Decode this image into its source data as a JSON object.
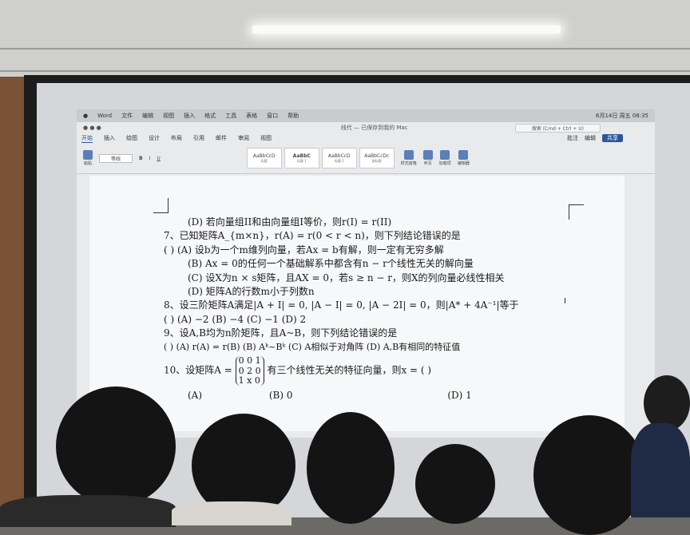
{
  "menubar": {
    "items": [
      "Word",
      "文件",
      "编辑",
      "视图",
      "插入",
      "格式",
      "工具",
      "表格",
      "窗口",
      "帮助"
    ],
    "clock": "6月14日 周五 08:35"
  },
  "titlebar": {
    "doc_title": "线代 — 已保存到我的 Mac",
    "search_placeholder": "搜索 (Cmd + Ctrl + U)"
  },
  "tabs": [
    "开始",
    "插入",
    "绘图",
    "设计",
    "布局",
    "引用",
    "邮件",
    "审阅",
    "视图"
  ],
  "tab_right": {
    "comments": "批注",
    "editing": "编辑",
    "share": "共享"
  },
  "ribbon": {
    "paste": "粘贴",
    "font": "等线",
    "styles": [
      {
        "sample": "AaBbCcD",
        "label": "标题"
      },
      {
        "sample": "AaBbC",
        "label": "标题 1"
      },
      {
        "sample": "AaBbCcD",
        "label": "标题 2"
      },
      {
        "sample": "AaBbCcDc",
        "label": "副标题"
      }
    ],
    "buttons": [
      "样式窗格",
      "听写",
      "加载项",
      "编辑器"
    ]
  },
  "document": {
    "lines": [
      "(D)  若向量组II和由向量组I等价，则r(I) = r(II)",
      "7、已知矩阵A_{m×n}，r(A) = r(0 < r < n)，则下列结论错误的是",
      "(    )     (A)  设b为一个m维列向量，若Ax = b有解，则一定有无穷多解",
      "(B)  Ax = 0的任何一个基础解系中都含有n − r个线性无关的解向量",
      "(C)  设X为n × s矩阵，且AX = 0，若s ≥ n − r，则X的列向量必线性相关",
      "(D)  矩阵A的行数m小于列数n",
      "8、设三阶矩阵A满足|A + I| = 0, |A − I| = 0, |A − 2I| = 0，则|A* + 4A⁻¹|等于",
      "(    )     (A)  −2          (B)  −4          (C)  −1          (D)   2",
      "9、设A,B均为n阶矩阵，且A~B，则下列结论错误的是",
      "(    )     (A)  r(A) = r(B)     (B)  Aᵏ~Bᵏ     (C)  A相似于对角阵     (D) A,B有相同的特征值",
      "10、设矩阵A =",
      "有三个线性无关的特征向量，则x = (    )",
      "(A)",
      "(B)  0",
      "(D)  1"
    ],
    "matrix_rows": [
      "0   0   1",
      "0   2   0",
      "1   x   0"
    ]
  }
}
